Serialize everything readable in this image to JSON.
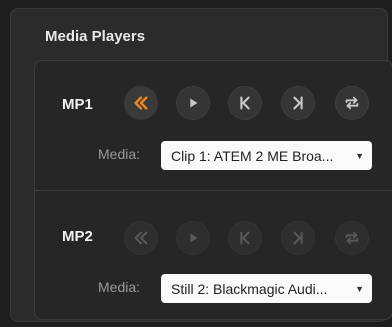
{
  "panel": {
    "title": "Media Players"
  },
  "players": [
    {
      "label": "MP1",
      "media_label": "Media:",
      "media_value": "Clip 1: ATEM 2 ME Broa...",
      "buttons": [
        "rewind-icon",
        "play-icon",
        "skip-previous-icon",
        "skip-next-icon",
        "loop-icon"
      ],
      "active_button": "rewind-icon",
      "enabled": true
    },
    {
      "label": "MP2",
      "media_label": "Media:",
      "media_value": "Still 2: Blackmagic Audi...",
      "buttons": [
        "rewind-icon",
        "play-icon",
        "skip-previous-icon",
        "skip-next-icon",
        "loop-icon"
      ],
      "enabled": false
    }
  ],
  "colors": {
    "accent": "#f28a1e",
    "icon": "#c8c8c8",
    "icon_dim": "#5a5a5a"
  }
}
